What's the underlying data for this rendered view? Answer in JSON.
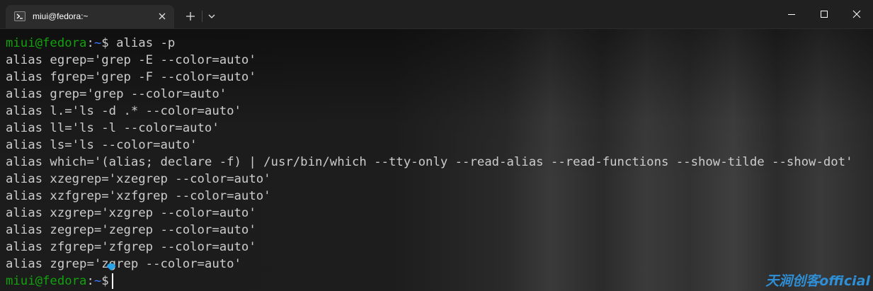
{
  "window": {
    "tab_title": "miui@fedora:~",
    "tab_icon": "terminal-icon",
    "buttons": [
      "close-icon",
      "plus-icon",
      "chevron-down-icon",
      "minimize-icon",
      "maximize-icon",
      "window-close-icon"
    ]
  },
  "terminal": {
    "prompt": {
      "user": "miui@fedora",
      "sep": ":",
      "path": "~",
      "symbol": "$"
    },
    "command": " alias -p",
    "output": [
      "alias egrep='grep -E --color=auto'",
      "alias fgrep='grep -F --color=auto'",
      "alias grep='grep --color=auto'",
      "alias l.='ls -d .* --color=auto'",
      "alias ll='ls -l --color=auto'",
      "alias ls='ls --color=auto'",
      "alias which='(alias; declare -f) | /usr/bin/which --tty-only --read-alias --read-functions --show-tilde --show-dot'",
      "alias xzegrep='xzegrep --color=auto'",
      "alias xzfgrep='xzfgrep --color=auto'",
      "alias xzgrep='xzgrep --color=auto'",
      "alias zegrep='zegrep --color=auto'",
      "alias zfgrep='zfgrep --color=auto'",
      "alias zgrep='zgrep --color=auto'"
    ]
  },
  "watermark": "天涧创客official",
  "colors": {
    "prompt_user": "#13a10e",
    "prompt_path": "#3b78ff",
    "text": "#cccccc",
    "watermark": "#2e8fd6",
    "background": "#1c1c1c"
  }
}
